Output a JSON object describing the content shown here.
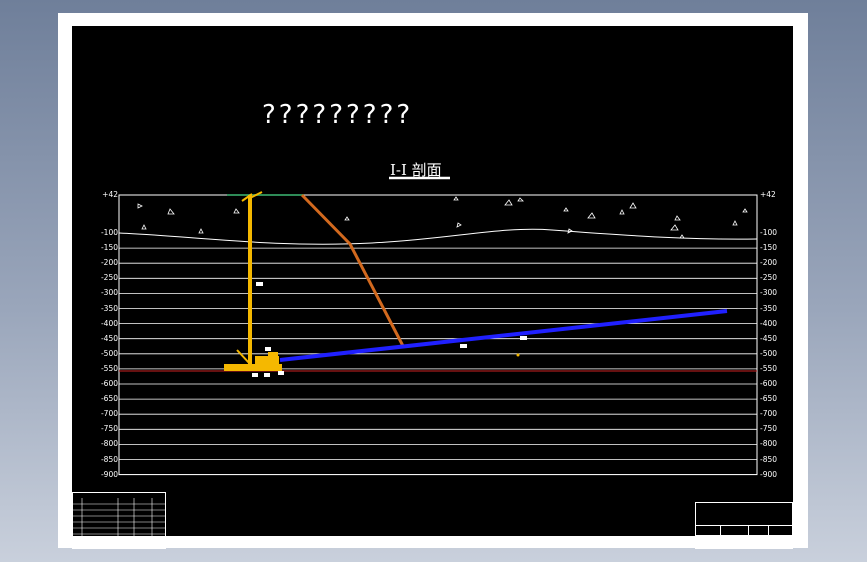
{
  "drawing": {
    "title": "?????????",
    "section_title": "I-I 剖面",
    "elevation_labels": [
      "+42",
      "-100",
      "-150",
      "-200",
      "-250",
      "-300",
      "-350",
      "-400",
      "-450",
      "-500",
      "-550",
      "-600",
      "-650",
      "-700",
      "-750",
      "-800",
      "-850",
      "-900"
    ]
  },
  "colors": {
    "background": "#000000",
    "grid": "#ffffff",
    "shaft": "#f5b800",
    "inclined_shaft": "#d2691e",
    "roadway": "#2020ff",
    "level_line": "#cc2222",
    "surface_marker": "#2e8b57"
  },
  "icons": {
    "surface_markers": "triangle"
  }
}
